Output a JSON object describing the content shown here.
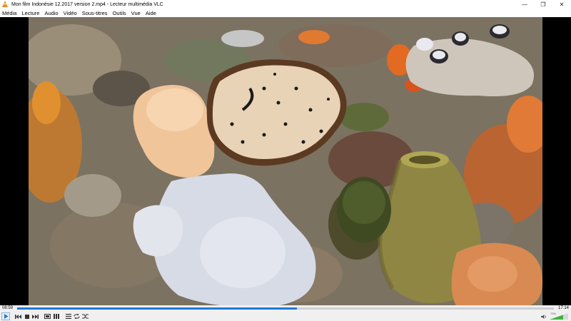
{
  "window": {
    "title": "Mon film Indonésie 12.2017 version 2.mp4 - Lecteur multimédia VLC",
    "controls": [
      "—",
      "❐",
      "✕"
    ]
  },
  "menu": {
    "items": [
      "Média",
      "Lecture",
      "Audio",
      "Vidéo",
      "Sous-titres",
      "Outils",
      "Vue",
      "Aide"
    ]
  },
  "player": {
    "time_elapsed": "08:59",
    "time_total": "17:14",
    "progress": 0.521,
    "volume_label": "73%",
    "volume": 0.73,
    "accent_color": "#1f78d8"
  },
  "icons": {
    "app": "vlc-cone-icon",
    "play": "play-icon",
    "previous": "previous-icon",
    "stop": "stop-icon",
    "next": "next-icon",
    "fullscreen": "fullscreen-icon",
    "extended": "extended-settings-icon",
    "playlist": "playlist-icon",
    "loop": "loop-icon",
    "shuffle": "shuffle-icon",
    "volume": "speaker-icon"
  }
}
